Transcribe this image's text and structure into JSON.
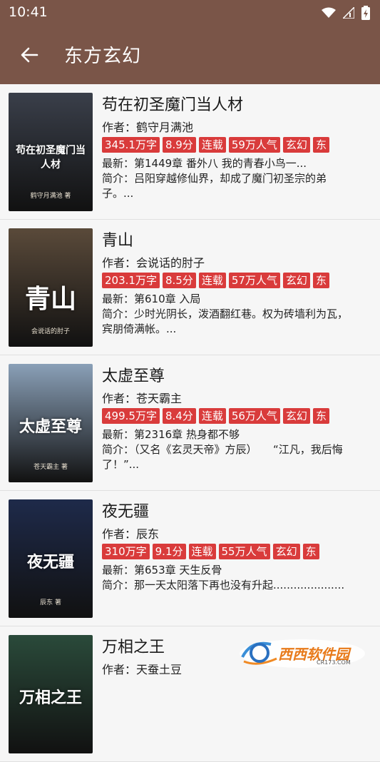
{
  "status": {
    "time": "10:41"
  },
  "header": {
    "title": "东方玄幻"
  },
  "books": [
    {
      "title": "苟在初圣魔门当人材",
      "author": "作者：鹤守月满池",
      "tags": [
        "345.1万字",
        "8.9分",
        "连载",
        "59万人气",
        "玄幻",
        "东"
      ],
      "latest": "最新：第1449章 番外八 我的青春小鸟一...",
      "summary": "简介：吕阳穿越修仙界，却成了魔门初圣宗的弟子。...",
      "cover_text": "苟在初圣魔门当人材",
      "cover_author": "鹤守月满池 著",
      "cover_color": "#3a3f4a"
    },
    {
      "title": "青山",
      "author": "作者：会说话的肘子",
      "tags": [
        "203.1万字",
        "8.5分",
        "连载",
        "57万人气",
        "玄幻",
        "东"
      ],
      "latest": "最新：第610章 入局",
      "summary": "简介：少时光阴长，泼酒翻红巷。权为砖墙利为瓦，宾朋倚满帐。...",
      "cover_text": "青山",
      "cover_author": "会说话的肘子",
      "cover_color": "#5a4a3a"
    },
    {
      "title": "太虚至尊",
      "author": "作者：苍天霸主",
      "tags": [
        "499.5万字",
        "8.4分",
        "连载",
        "56万人气",
        "玄幻",
        "东"
      ],
      "latest": "最新：第2316章 热身都不够",
      "summary": "简介：（又名《玄灵天帝》方辰）　　“江凡，我后悔了！”...",
      "cover_text": "太虚至尊",
      "cover_author": "苍天霸主 著",
      "cover_color": "#8aa0b8"
    },
    {
      "title": "夜无疆",
      "author": "作者：辰东",
      "tags": [
        "310万字",
        "9.1分",
        "连载",
        "55万人气",
        "玄幻",
        "东"
      ],
      "latest": "最新：第653章 天生反骨",
      "summary": "简介：那一天太阳落下再也没有升起.....................",
      "cover_text": "夜无疆",
      "cover_author": "辰东 著",
      "cover_color": "#1e2a4a"
    },
    {
      "title": "万相之王",
      "author": "作者：天蚕土豆",
      "tags": [],
      "latest": "",
      "summary": "",
      "cover_text": "万相之王",
      "cover_author": "",
      "cover_color": "#2a4a3a"
    }
  ],
  "watermark": {
    "text": "西西软件园",
    "sub": "CR173.COM"
  }
}
